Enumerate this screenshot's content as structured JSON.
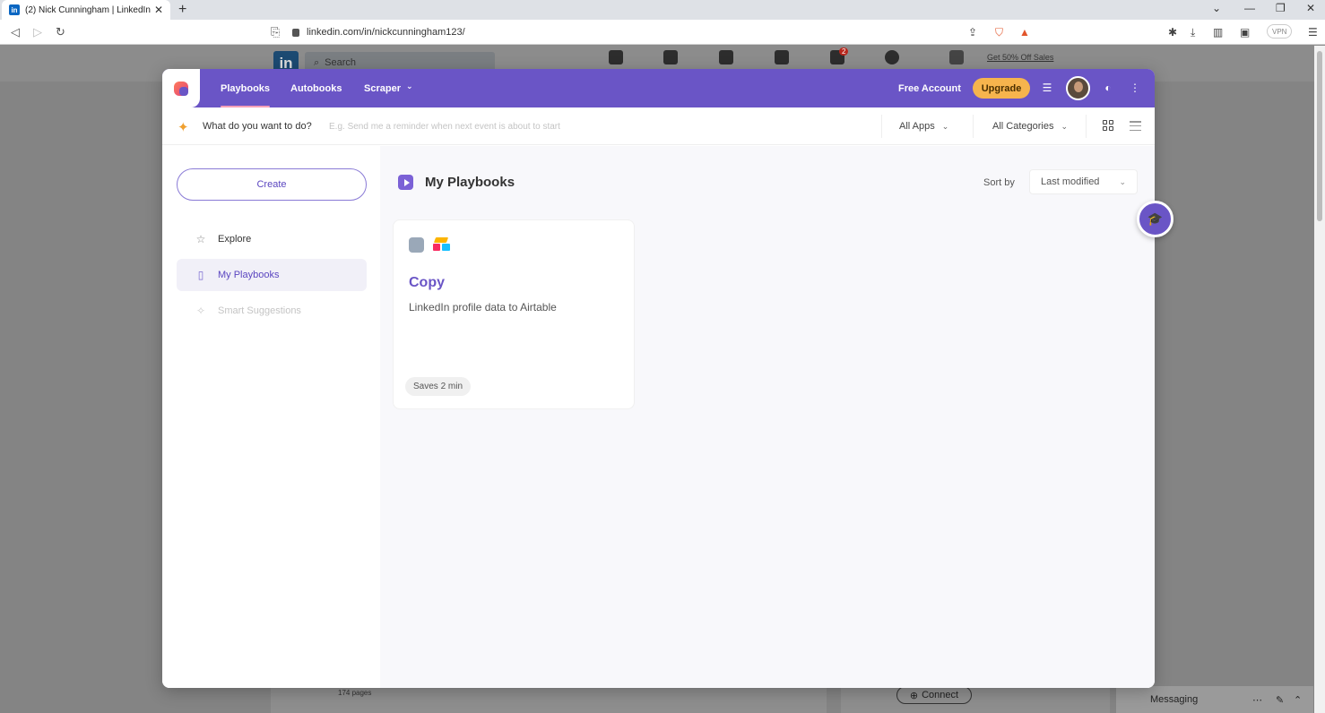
{
  "browser": {
    "tab_title": "(2) Nick Cunningham | LinkedIn",
    "favicon_text": "in",
    "url": "linkedin.com/in/nickcunningham123/",
    "vpn_label": "VPN"
  },
  "linkedin": {
    "logo": "in",
    "search_placeholder": "Search",
    "promo": "Get 50% Off Sales",
    "notification_count": "2",
    "connect_label": "Connect",
    "messaging_label": "Messaging",
    "pages_text": "174 pages"
  },
  "extension": {
    "nav": {
      "tabs": [
        {
          "label": "Playbooks",
          "active": true
        },
        {
          "label": "Autobooks",
          "active": false
        },
        {
          "label": "Scraper",
          "active": false
        }
      ],
      "scraper_chevron": "⌄",
      "free_account": "Free Account",
      "upgrade": "Upgrade"
    },
    "search": {
      "label": "What do you want to do?",
      "placeholder": "E.g. Send me a reminder when next event is about to start",
      "apps_filter": "All Apps",
      "categories_filter": "All Categories"
    },
    "sidebar": {
      "create": "Create",
      "items": [
        {
          "label": "Explore",
          "icon": "star-icon"
        },
        {
          "label": "My Playbooks",
          "icon": "book-icon"
        },
        {
          "label": "Smart Suggestions",
          "icon": "sparkle-icon"
        }
      ]
    },
    "main": {
      "title": "My Playbooks",
      "sort_label": "Sort by",
      "sort_value": "Last modified",
      "cards": [
        {
          "title": "Copy",
          "description": "LinkedIn profile data to Airtable",
          "saves": "Saves 2 min",
          "apps": [
            "notes-app-icon",
            "airtable-icon"
          ]
        }
      ]
    },
    "colors": {
      "brand": "#6a55c6",
      "upgrade": "#f6b44d"
    }
  }
}
